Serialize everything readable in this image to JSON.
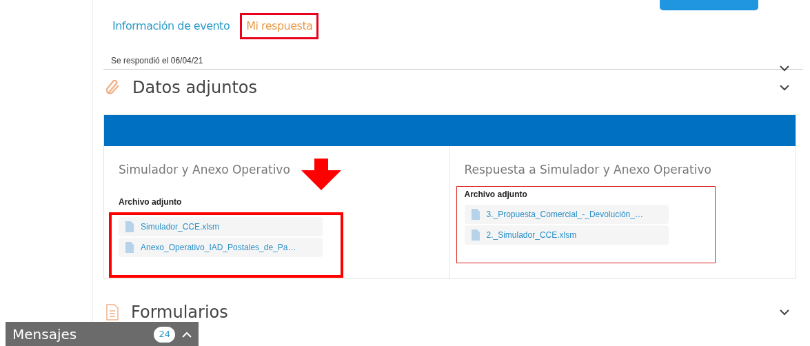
{
  "tabs": [
    {
      "label": "Información de evento",
      "selected": false
    },
    {
      "label": "Mi respuesta",
      "selected": true
    }
  ],
  "response_note": "Se respondió el 06/04/21",
  "sections": [
    {
      "title": "Datos adjuntos",
      "kind": "attachments",
      "columns": [
        {
          "title": "Simulador y Anexo Operativo",
          "label": "Archivo adjunto",
          "files": [
            "Simulador_CCE.xlsm",
            "Anexo_Operativo_IAD_Postales_de_Pa…"
          ]
        },
        {
          "title": "Respuesta a Simulador y Anexo Operativo",
          "label": "Archivo adjunto",
          "files": [
            "3._Propuesta_Comercial_-_Devolución_…",
            "2._Simulador_CCE.xlsm"
          ]
        }
      ]
    },
    {
      "title": "Formularios",
      "kind": "forms"
    }
  ],
  "messages": {
    "label": "Mensajes",
    "count": "24"
  }
}
